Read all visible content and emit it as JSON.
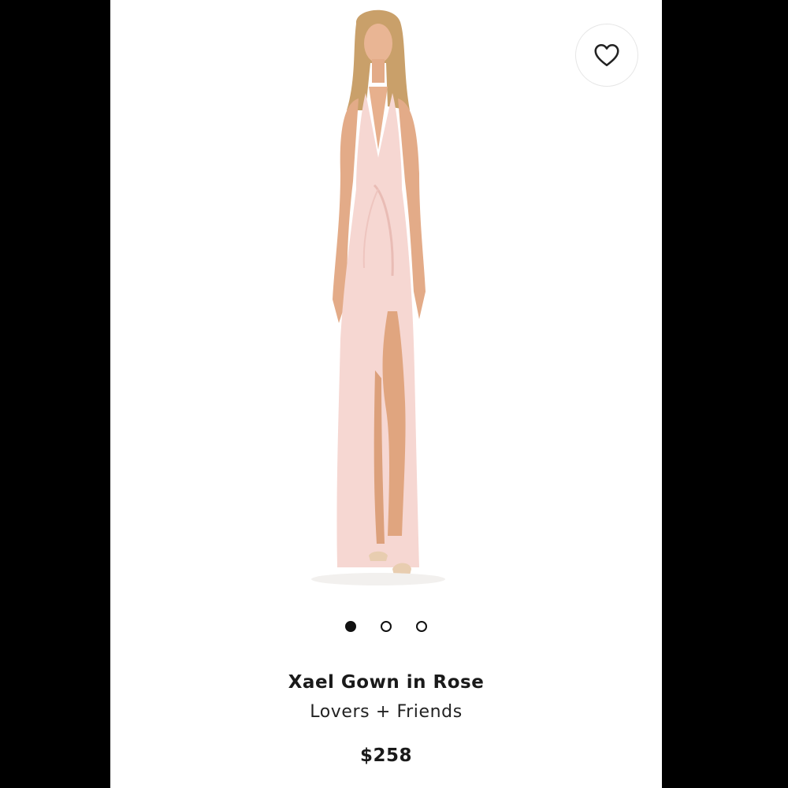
{
  "product": {
    "title": "Xael Gown in Rose",
    "brand": "Lovers + Friends",
    "price": "$258"
  },
  "gallery": {
    "image_count": 3,
    "active_index": 0
  },
  "icons": {
    "favorite": "heart-outline-icon"
  },
  "colors": {
    "dress": "#f6d7d2",
    "text": "#1a1a1a",
    "background": "#ffffff"
  }
}
